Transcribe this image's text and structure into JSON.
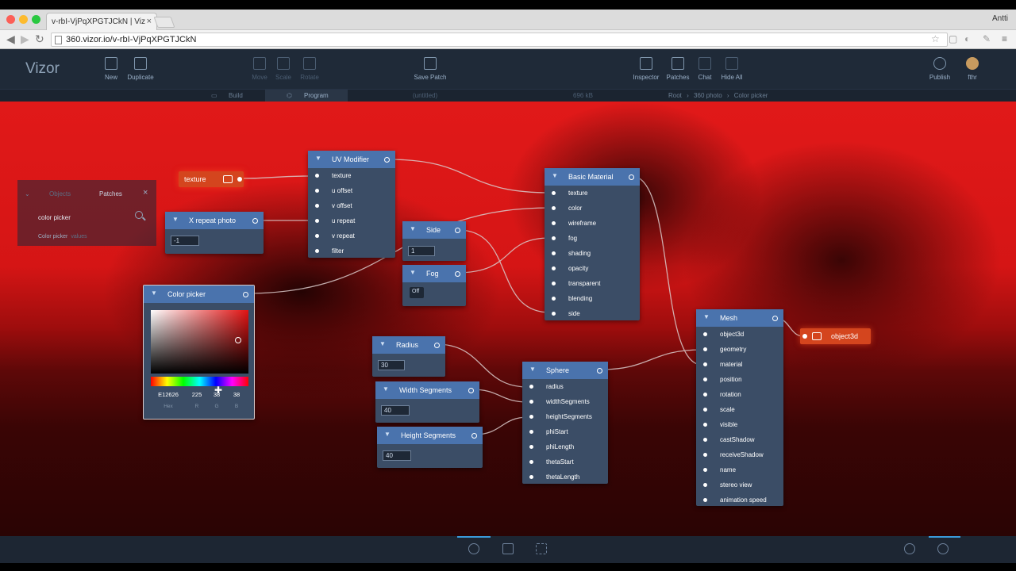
{
  "browser": {
    "tab_title": "v-rbI-VjPqXPGTJCkN | Viz",
    "tab_close": "×",
    "user": "Antti",
    "url": "360.vizor.io/v-rbI-VjPqXPGTJCkN",
    "back": "◀",
    "forward": "▶",
    "reload": "↻",
    "traffic_colors": [
      "#fc5f57",
      "#fdbb2e",
      "#29c840"
    ]
  },
  "app": {
    "logo": "Vizor",
    "toolbar": {
      "new": "New",
      "duplicate": "Duplicate",
      "move": "Move",
      "scale": "Scale",
      "rotate": "Rotate",
      "save_patch": "Save Patch",
      "inspector": "Inspector",
      "patches": "Patches",
      "chat": "Chat",
      "hide_all": "Hide All",
      "publish": "Publish",
      "user": "fthr"
    },
    "subbar": {
      "build": "Build",
      "program": "Program",
      "title": "(untitled)",
      "size": "696 kB",
      "breadcrumb": [
        "Root",
        "360 photo",
        "Color picker"
      ],
      "sep": "›"
    }
  },
  "library": {
    "tab_objects": "Objects",
    "tab_patches": "Patches",
    "close": "×",
    "search_value": "color picker",
    "result": "Color picker",
    "result_sub": "values"
  },
  "proxies": {
    "texture": "texture",
    "object3d": "object3d"
  },
  "nodes": {
    "x_repeat": {
      "title": "X repeat photo",
      "value": "-1"
    },
    "uv_modifier": {
      "title": "UV Modifier",
      "ports": [
        "texture",
        "u offset",
        "v offset",
        "u repeat",
        "v repeat",
        "filter"
      ]
    },
    "side": {
      "title": "Side",
      "value": "1"
    },
    "fog": {
      "title": "Fog",
      "value": "Off"
    },
    "basic_material": {
      "title": "Basic Material",
      "ports": [
        "texture",
        "color",
        "wireframe",
        "fog",
        "shading",
        "opacity",
        "transparent",
        "blending",
        "side"
      ]
    },
    "color_picker": {
      "title": "Color picker",
      "hex": "E12626",
      "r": "225",
      "g": "38",
      "b": "38",
      "hex_label": "Hex",
      "r_label": "R",
      "g_label": "G",
      "b_label": "B"
    },
    "radius": {
      "title": "Radius",
      "value": "30"
    },
    "width_segments": {
      "title": "Width Segments",
      "value": "40"
    },
    "height_segments": {
      "title": "Height Segments",
      "value": "40"
    },
    "sphere": {
      "title": "Sphere",
      "ports": [
        "radius",
        "widthSegments",
        "heightSegments",
        "phiStart",
        "phiLength",
        "thetaStart",
        "thetaLength"
      ]
    },
    "mesh": {
      "title": "Mesh",
      "ports": [
        "object3d",
        "geometry",
        "material",
        "position",
        "rotation",
        "scale",
        "visible",
        "castShadow",
        "receiveShadow",
        "name",
        "stereo view",
        "animation speed"
      ]
    }
  },
  "colors": {
    "node_header": "#4a73ad",
    "node_body": "#3b4d66",
    "proxy": "#d4451e",
    "accent": "#3a9ad9"
  }
}
